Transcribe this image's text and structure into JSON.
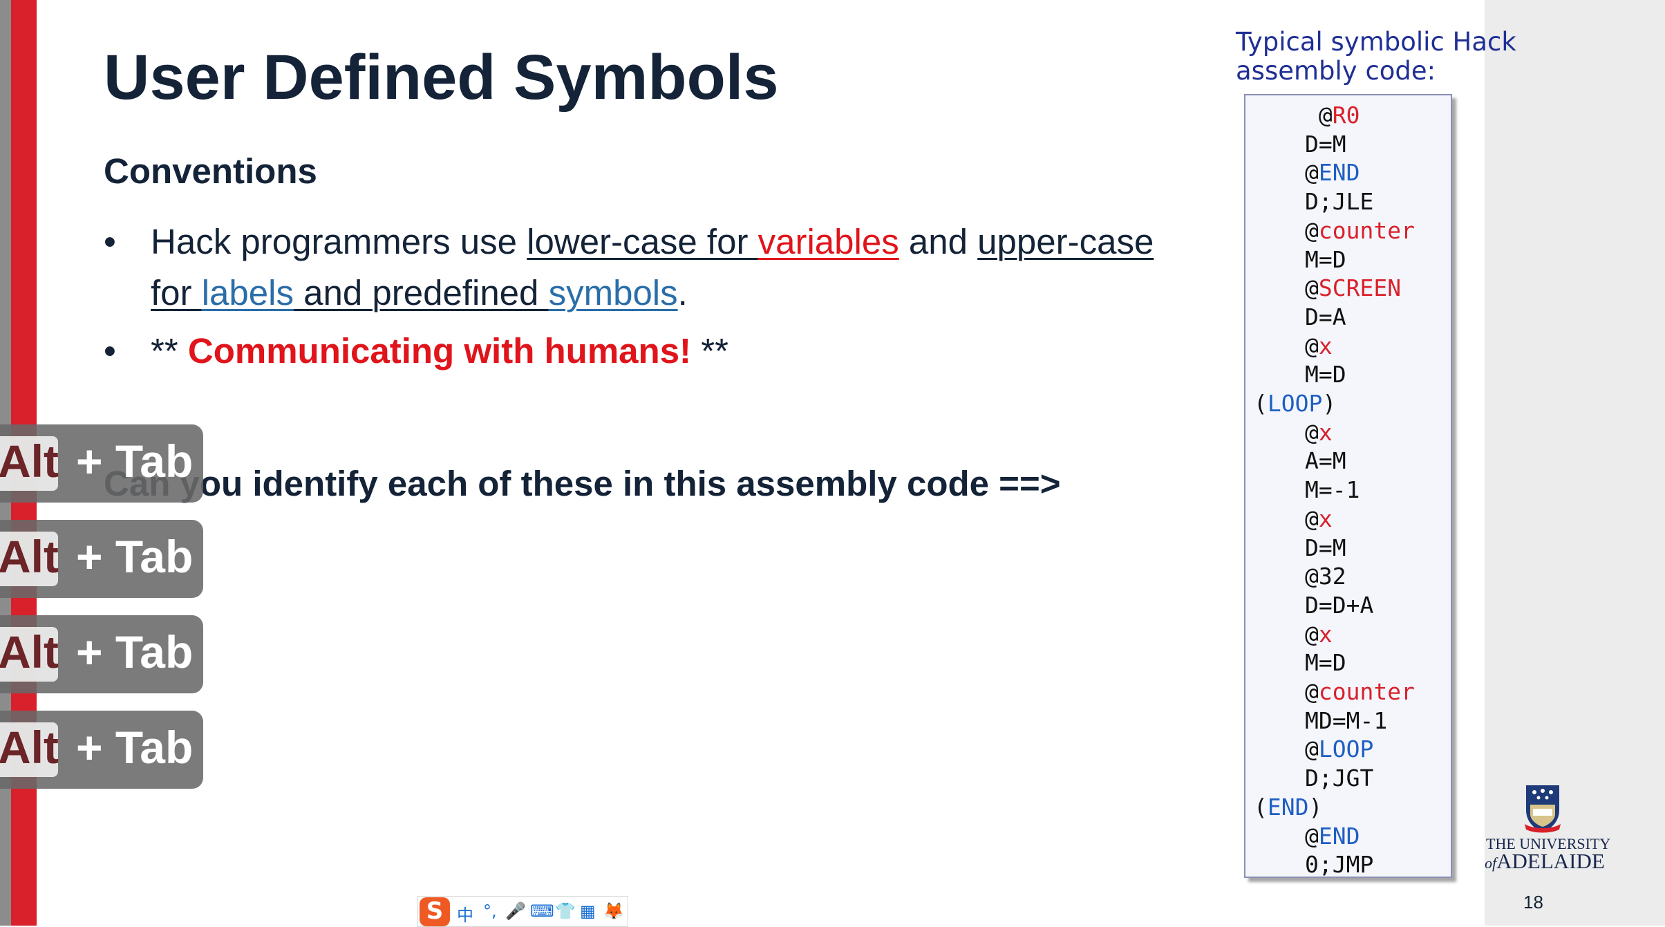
{
  "slide": {
    "title": "User Defined Symbols",
    "subheading": "Conventions",
    "bullet_marker": "•",
    "bullet1": {
      "part1": "Hack programmers use ",
      "part2": "lower-case for ",
      "part3": "variables",
      "part4": " and ",
      "part5": "upper-case",
      "part6": "for ",
      "part7": "labels",
      "part8": " and predefined ",
      "part9": "symbols",
      "part10": "."
    },
    "bullet2": {
      "prefix": "** ",
      "highlight": "Communicating with humans!",
      "suffix": " **"
    },
    "question": "Can you identify each of these in this assembly code ==>",
    "page_number": "18"
  },
  "overlay": {
    "alt_label": "Alt",
    "tab_label": "+ Tab"
  },
  "code": {
    "caption_line1": "Typical symbolic Hack",
    "caption_line2": "assembly code:",
    "lines": [
      {
        "pre": " @",
        "sym": "R0",
        "type": "red"
      },
      {
        "pre": "D=M",
        "sym": "",
        "type": ""
      },
      {
        "pre": "@",
        "sym": "END",
        "type": "blue"
      },
      {
        "pre": "D;JLE",
        "sym": "",
        "type": ""
      },
      {
        "pre": "@",
        "sym": "counter",
        "type": "red"
      },
      {
        "pre": "M=D",
        "sym": "",
        "type": ""
      },
      {
        "pre": "@",
        "sym": "SCREEN",
        "type": "red"
      },
      {
        "pre": "D=A",
        "sym": "",
        "type": ""
      },
      {
        "pre": "@",
        "sym": "x",
        "type": "red"
      },
      {
        "pre": "M=D",
        "sym": "",
        "type": ""
      },
      {
        "pre": "(",
        "sym": "LOOP",
        "type": "blue",
        "post": ")",
        "label": true
      },
      {
        "pre": "@",
        "sym": "x",
        "type": "red"
      },
      {
        "pre": "A=M",
        "sym": "",
        "type": ""
      },
      {
        "pre": "M=-1",
        "sym": "",
        "type": ""
      },
      {
        "pre": "@",
        "sym": "x",
        "type": "red"
      },
      {
        "pre": "D=M",
        "sym": "",
        "type": ""
      },
      {
        "pre": "@32",
        "sym": "",
        "type": ""
      },
      {
        "pre": "D=D+A",
        "sym": "",
        "type": ""
      },
      {
        "pre": "@",
        "sym": "x",
        "type": "red"
      },
      {
        "pre": "M=D",
        "sym": "",
        "type": ""
      },
      {
        "pre": "@",
        "sym": "counter",
        "type": "red"
      },
      {
        "pre": "MD=M-1",
        "sym": "",
        "type": ""
      },
      {
        "pre": "@",
        "sym": "LOOP",
        "type": "blue"
      },
      {
        "pre": "D;JGT",
        "sym": "",
        "type": ""
      },
      {
        "pre": "(",
        "sym": "END",
        "type": "blue",
        "post": ")",
        "label": true
      },
      {
        "pre": "@",
        "sym": "END",
        "type": "blue"
      },
      {
        "pre": "0;JMP",
        "sym": "",
        "type": ""
      }
    ]
  },
  "logo": {
    "line1": "THE UNIVERSITY",
    "line2_prefix": "of",
    "line2": "ADELAIDE"
  },
  "ime": {
    "logo": "S",
    "items": [
      "中",
      "°,",
      "🎤",
      "⌨",
      "👕",
      "▦",
      "🦊"
    ]
  },
  "colors": {
    "accent_red": "#d8212b",
    "title_navy": "#142337",
    "link_blue": "#2a6ea9",
    "code_red": "#d8212b",
    "code_blue": "#1f5fc2"
  }
}
